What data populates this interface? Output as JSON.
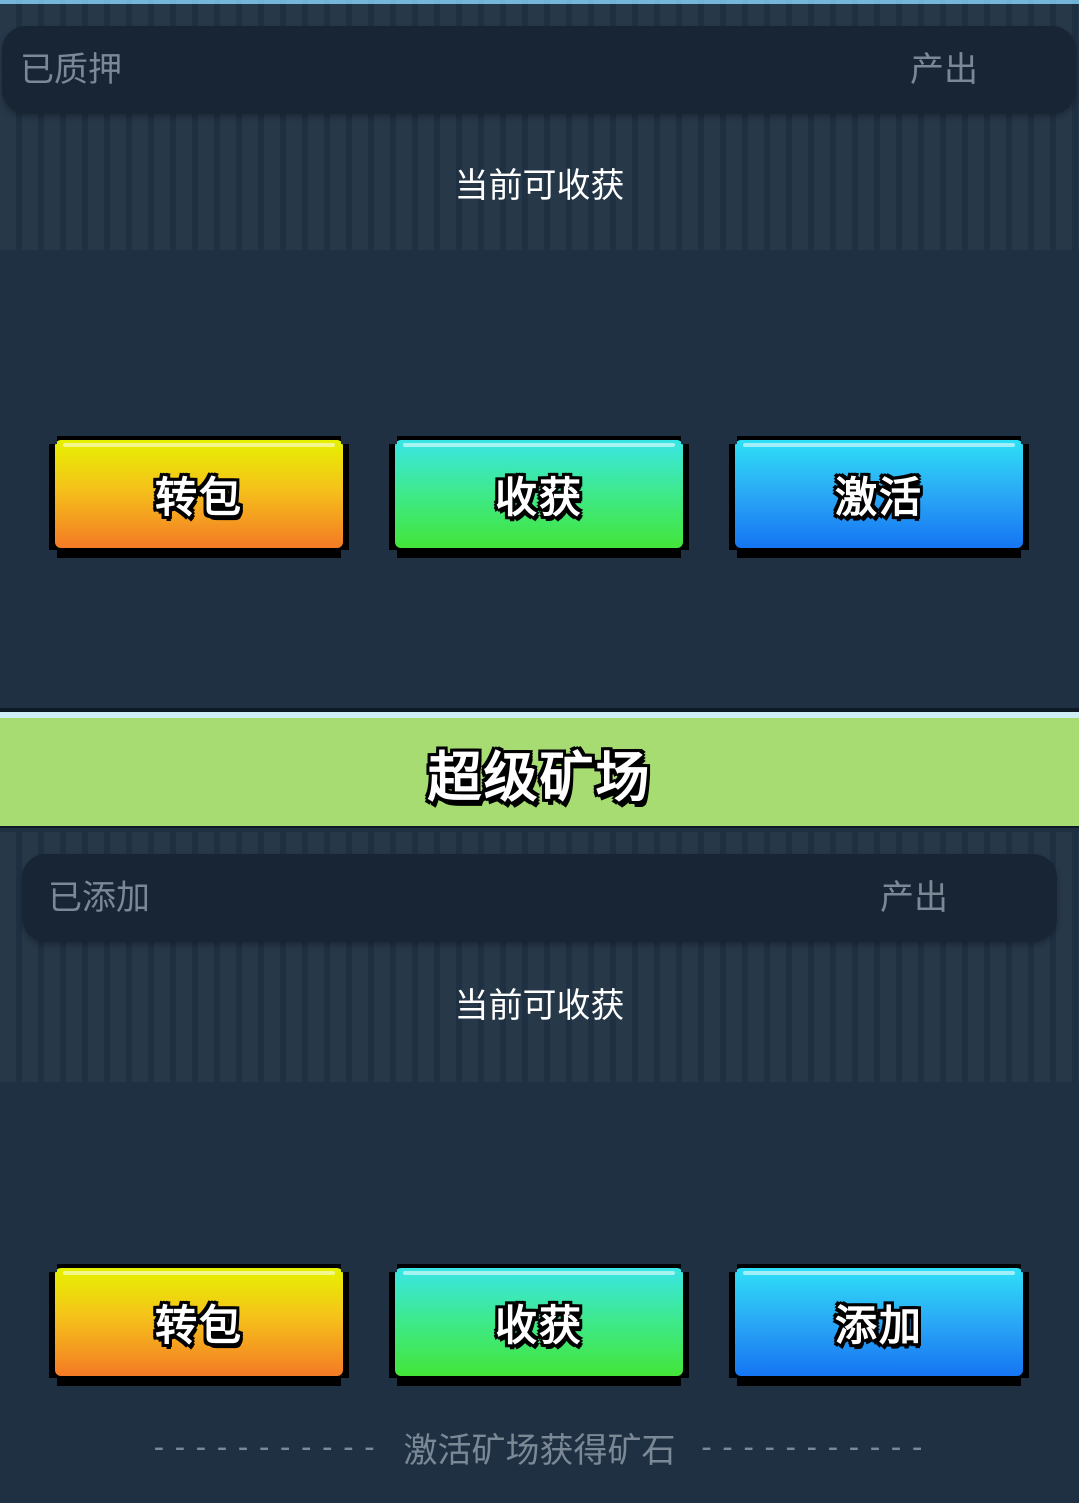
{
  "top_section": {
    "staked_label": "已质押",
    "output_label": "产出",
    "harvestable_label": "当前可收获",
    "buttons": {
      "transfer": "转包",
      "harvest": "收获",
      "activate": "激活"
    }
  },
  "super_mine": {
    "title": "超级矿场",
    "added_label": "已添加",
    "output_label": "产出",
    "harvestable_label": "当前可收获",
    "buttons": {
      "transfer": "转包",
      "harvest": "收获",
      "add": "添加"
    },
    "footer_note": "激活矿场获得矿石",
    "footer_dashes": "-----------"
  },
  "colors": {
    "background": "#1f3042",
    "card": "#172534",
    "banner": "#a6dc72",
    "yellow_button": "#f5c21a",
    "green_button": "#3ee98a",
    "blue_button": "#2aa8f5"
  }
}
